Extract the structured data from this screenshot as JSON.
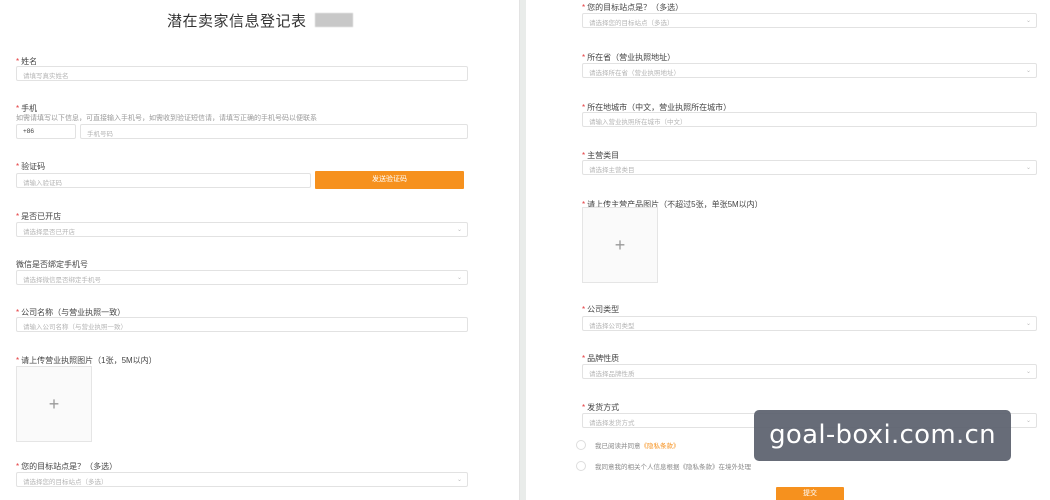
{
  "form_title": "潜在卖家信息登记表",
  "left": {
    "name": {
      "label": "姓名",
      "placeholder": "请填写真实姓名"
    },
    "phone": {
      "label": "手机",
      "hint": "如需请填写以下信息，可直接输入手机号，如需收到验证短信请，请填写正确的手机号码以便联系",
      "country_code": "+86",
      "placeholder": "手机号码"
    },
    "code": {
      "label": "验证码",
      "placeholder": "请输入验证码",
      "button": "发送验证码"
    },
    "opened": {
      "label": "是否已开店",
      "placeholder": "请选择是否已开店"
    },
    "wechat": {
      "label": "微信是否绑定手机号",
      "placeholder": "请选择微信是否绑定手机号"
    },
    "company": {
      "label": "公司名称（与营业执照一致）",
      "placeholder": "请输入公司名称（与营业执照一致）"
    },
    "license": {
      "label": "请上传营业执照图片（1张，5M以内）"
    },
    "target": {
      "label": "您的目标站点是？（多选）",
      "placeholder": "请选择您的目标站点（多选）"
    }
  },
  "right": {
    "target": {
      "label": "您的目标站点是？（多选）",
      "placeholder": "请选择您的目标站点（多选）"
    },
    "province": {
      "label": "所在省（营业执照地址）",
      "placeholder": "请选择所在省（营业执照地址）"
    },
    "city": {
      "label": "所在地城市（中文，营业执照所在城市）",
      "placeholder": "请输入营业执照所在城市（中文）"
    },
    "category": {
      "label": "主营类目",
      "placeholder": "请选择主营类目"
    },
    "product": {
      "label": "请上传主营产品图片（不超过5张，单张5M以内）"
    },
    "company_type": {
      "label": "公司类型",
      "placeholder": "请选择公司类型"
    },
    "brand": {
      "label": "品牌性质",
      "placeholder": "请选择品牌性质"
    },
    "shipping": {
      "label": "发货方式",
      "placeholder": "请选择发货方式"
    },
    "agree1_text": "我已阅读并同意",
    "agree1_link": "《隐私条款》",
    "agree2_text": "我同意我的相关个人信息根据《隐私条款》在境外处理",
    "submit": "提交"
  },
  "watermark": "goal-boxi.com.cn"
}
